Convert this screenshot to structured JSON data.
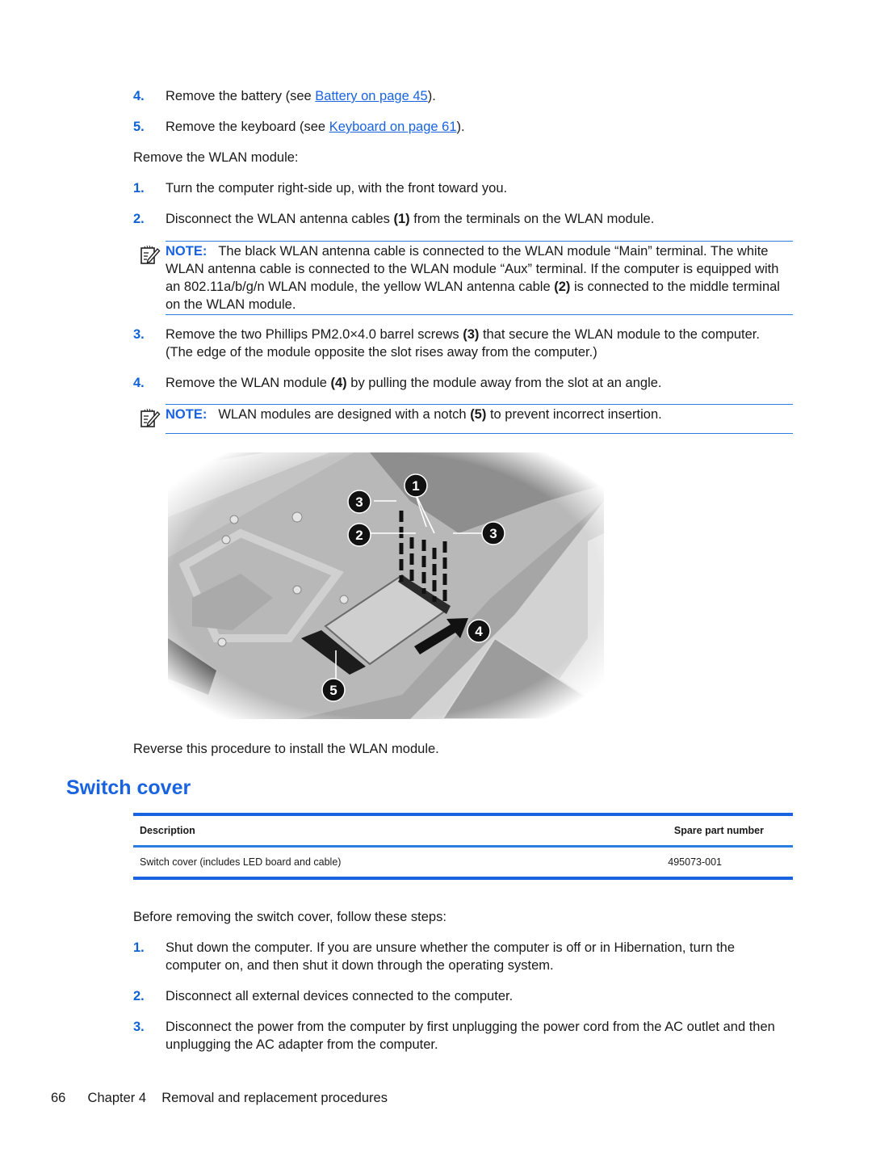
{
  "pre_steps": [
    {
      "num": "4.",
      "before": "Remove the battery (see ",
      "link": "Battery on page 45",
      "after": ")."
    },
    {
      "num": "5.",
      "before": "Remove the keyboard (see ",
      "link": "Keyboard on page 61",
      "after": ")."
    }
  ],
  "wlan_intro": "Remove the WLAN module:",
  "wlan_steps": [
    {
      "num": "1.",
      "text": "Turn the computer right-side up, with the front toward you."
    },
    {
      "num": "2.",
      "text_before": "Disconnect the WLAN antenna cables ",
      "bold": "(1)",
      "text_after": " from the terminals on the WLAN module."
    },
    {
      "num": "3.",
      "text_before": "Remove the two Phillips PM2.0×4.0 barrel screws ",
      "bold": "(3)",
      "text_after": " that secure the WLAN module to the computer. (The edge of the module opposite the slot rises away from the computer.)"
    },
    {
      "num": "4.",
      "text_before": "Remove the WLAN module ",
      "bold": "(4)",
      "text_after": " by pulling the module away from the slot at an angle."
    }
  ],
  "notes": [
    {
      "label": "NOTE:",
      "text_before": "The black WLAN antenna cable is connected to the WLAN module “Main” terminal. The white WLAN antenna cable is connected to the WLAN module “Aux” terminal. If the computer is equipped with an 802.11a/b/g/n WLAN module, the yellow WLAN antenna cable ",
      "bold": "(2)",
      "text_after": " is connected to the middle terminal on the WLAN module."
    },
    {
      "label": "NOTE:",
      "text_before": "WLAN modules are designed with a notch ",
      "bold": "(5)",
      "text_after": " to prevent incorrect insertion."
    }
  ],
  "figure": {
    "callouts": [
      "1",
      "2",
      "3",
      "3",
      "4",
      "5"
    ]
  },
  "reverse_text": "Reverse this procedure to install the WLAN module.",
  "section_title": "Switch cover",
  "parts_table": {
    "headers": [
      "Description",
      "Spare part number"
    ],
    "rows": [
      [
        "Switch cover (includes LED board and cable)",
        "495073-001"
      ]
    ]
  },
  "switch_intro": "Before removing the switch cover, follow these steps:",
  "switch_steps": [
    {
      "num": "1.",
      "text": "Shut down the computer. If you are unsure whether the computer is off or in Hibernation, turn the computer on, and then shut it down through the operating system."
    },
    {
      "num": "2.",
      "text": "Disconnect all external devices connected to the computer."
    },
    {
      "num": "3.",
      "text": "Disconnect the power from the computer by first unplugging the power cord from the AC outlet and then unplugging the AC adapter from the computer."
    }
  ],
  "footer": {
    "page_number": "66",
    "chapter": "Chapter 4",
    "chapter_title": "Removal and replacement procedures"
  },
  "colors": {
    "accent_blue": "#1a63e0",
    "rule_blue": "#2a7de1",
    "text": "#1a1a1a"
  }
}
